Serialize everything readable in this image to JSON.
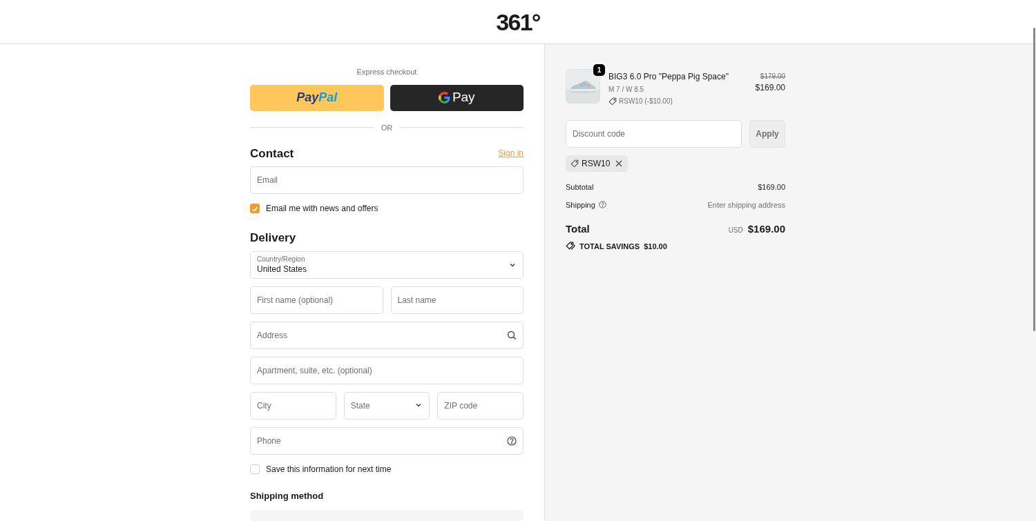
{
  "header": {
    "logo": "361°"
  },
  "express": {
    "title": "Express checkout",
    "paypal": {
      "first": "Pay",
      "second": "Pal"
    },
    "gpay": {
      "label": "Pay"
    },
    "divider": "OR"
  },
  "contact": {
    "title": "Contact",
    "sign_in": "Sign in",
    "email": {
      "placeholder": "Email"
    },
    "newsletter": {
      "label": "Email me with news and offers",
      "checked": true
    }
  },
  "delivery": {
    "title": "Delivery",
    "rows": [
      [
        {
          "kind": "select",
          "label": "Country/Region",
          "value": "United States"
        }
      ],
      [
        {
          "kind": "text",
          "placeholder": "First name (optional)"
        },
        {
          "kind": "text",
          "placeholder": "Last name"
        }
      ],
      [
        {
          "kind": "search",
          "placeholder": "Address"
        }
      ],
      [
        {
          "kind": "text",
          "placeholder": "Apartment, suite, etc. (optional)"
        }
      ],
      [
        {
          "kind": "text",
          "placeholder": "City"
        },
        {
          "kind": "select",
          "placeholder": "State"
        },
        {
          "kind": "text",
          "placeholder": "ZIP code"
        }
      ],
      [
        {
          "kind": "help",
          "placeholder": "Phone"
        }
      ]
    ],
    "save": {
      "label": "Save this information for next time",
      "checked": false
    }
  },
  "shipping_method": {
    "title": "Shipping method"
  },
  "summary": {
    "item": {
      "quantity": "1",
      "name": "BIG3 6.0 Pro \"Peppa Pig Space\"",
      "variant": "M 7 / W 8.5",
      "discount": "RSW10 (-$10.00)",
      "old_price": "$179.00",
      "price": "$169.00"
    },
    "discount_field": {
      "placeholder": "Discount code"
    },
    "apply": "Apply",
    "applied_code": "RSW10",
    "subtotal": {
      "label": "Subtotal",
      "value": "$169.00"
    },
    "shipping": {
      "label": "Shipping",
      "value": "Enter shipping address"
    },
    "total": {
      "label": "Total",
      "currency": "USD",
      "value": "$169.00"
    },
    "savings": {
      "label": "TOTAL SAVINGS",
      "value": "$10.00"
    }
  }
}
